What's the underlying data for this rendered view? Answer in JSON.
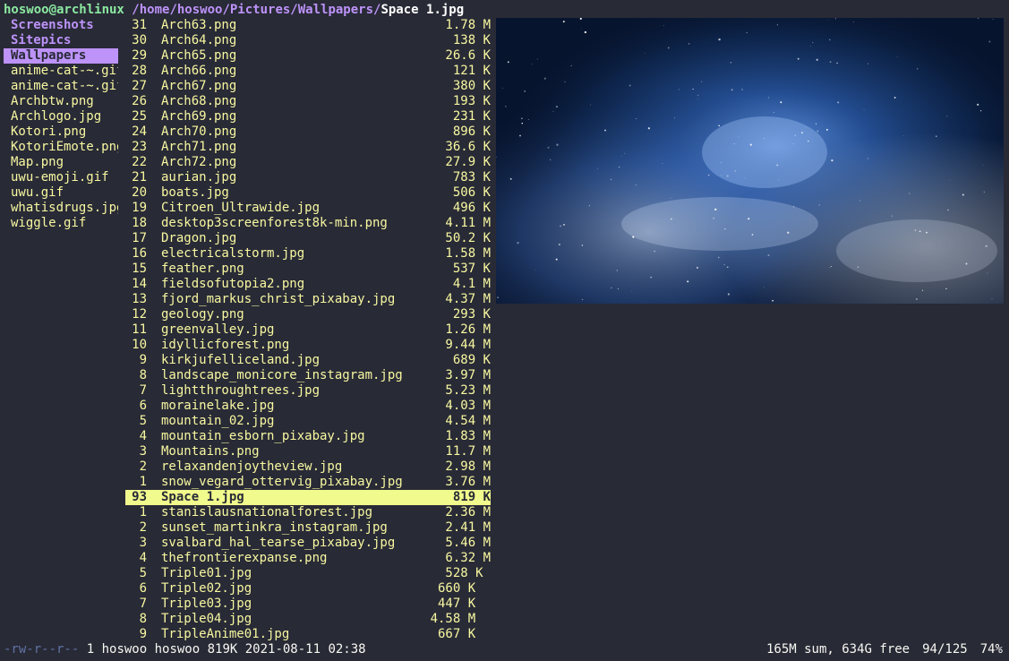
{
  "header": {
    "user_host": "hoswoo@archlinux",
    "path": "/home/hoswoo/Pictures/Wallpapers/",
    "current_file": "Space 1.jpg"
  },
  "parent_column": [
    {
      "name": "Screenshots",
      "type": "dir"
    },
    {
      "name": "Sitepics",
      "type": "dir"
    },
    {
      "name": "Wallpapers",
      "type": "dir",
      "selected": true
    },
    {
      "name": "anime-cat-~.gif"
    },
    {
      "name": "anime-cat-~.gif"
    },
    {
      "name": "Archbtw.png"
    },
    {
      "name": "Archlogo.jpg"
    },
    {
      "name": "Kotori.png"
    },
    {
      "name": "KotoriEmote.png"
    },
    {
      "name": "Map.png"
    },
    {
      "name": "uwu-emoji.gif"
    },
    {
      "name": "uwu.gif"
    },
    {
      "name": "whatisdrugs.jpg"
    },
    {
      "name": "wiggle.gif"
    }
  ],
  "files": [
    {
      "num": "31",
      "name": "Arch63.png",
      "size": "1.78 M"
    },
    {
      "num": "30",
      "name": "Arch64.png",
      "size": "138 K"
    },
    {
      "num": "29",
      "name": "Arch65.png",
      "size": "26.6 K"
    },
    {
      "num": "28",
      "name": "Arch66.png",
      "size": "121 K"
    },
    {
      "num": "27",
      "name": "Arch67.png",
      "size": "380 K"
    },
    {
      "num": "26",
      "name": "Arch68.png",
      "size": "193 K"
    },
    {
      "num": "25",
      "name": "Arch69.png",
      "size": "231 K"
    },
    {
      "num": "24",
      "name": "Arch70.png",
      "size": "896 K"
    },
    {
      "num": "23",
      "name": "Arch71.png",
      "size": "36.6 K"
    },
    {
      "num": "22",
      "name": "Arch72.png",
      "size": "27.9 K"
    },
    {
      "num": "21",
      "name": "aurian.jpg",
      "size": "783 K"
    },
    {
      "num": "20",
      "name": "boats.jpg",
      "size": "506 K"
    },
    {
      "num": "19",
      "name": "Citroen_Ultrawide.jpg",
      "size": "496 K"
    },
    {
      "num": "18",
      "name": "desktop3screenforest8k-min.png",
      "size": "4.11 M"
    },
    {
      "num": "17",
      "name": "Dragon.jpg",
      "size": "50.2 K"
    },
    {
      "num": "16",
      "name": "electricalstorm.jpg",
      "size": "1.58 M"
    },
    {
      "num": "15",
      "name": "feather.png",
      "size": "537 K"
    },
    {
      "num": "14",
      "name": "fieldsofutopia2.png",
      "size": "4.1 M"
    },
    {
      "num": "13",
      "name": "fjord_markus_christ_pixabay.jpg",
      "size": "4.37 M"
    },
    {
      "num": "12",
      "name": "geology.png",
      "size": "293 K"
    },
    {
      "num": "11",
      "name": "greenvalley.jpg",
      "size": "1.26 M"
    },
    {
      "num": "10",
      "name": "idyllicforest.png",
      "size": "9.44 M"
    },
    {
      "num": "9",
      "name": "kirkjufelliceland.jpg",
      "size": "689 K"
    },
    {
      "num": "8",
      "name": "landscape_monicore_instagram.jpg",
      "size": "3.97 M"
    },
    {
      "num": "7",
      "name": "lightthroughtrees.jpg",
      "size": "5.23 M"
    },
    {
      "num": "6",
      "name": "morainelake.jpg",
      "size": "4.03 M"
    },
    {
      "num": "5",
      "name": "mountain_02.jpg",
      "size": "4.54 M"
    },
    {
      "num": "4",
      "name": "mountain_esborn_pixabay.jpg",
      "size": "1.83 M"
    },
    {
      "num": "3",
      "name": "Mountains.png",
      "size": "11.7 M"
    },
    {
      "num": "2",
      "name": "relaxandenjoytheview.jpg",
      "size": "2.98 M"
    },
    {
      "num": "1",
      "name": "snow_vegard_ottervig_pixabay.jpg",
      "size": "3.76 M"
    },
    {
      "num": "93",
      "name": "Space 1.jpg",
      "size": "819 K",
      "selected": true
    },
    {
      "num": "1",
      "name": "stanislausnationalforest.jpg",
      "size": "2.36 M"
    },
    {
      "num": "2",
      "name": "sunset_martinkra_instagram.jpg",
      "size": "2.41 M"
    },
    {
      "num": "3",
      "name": "svalbard_hal_tearse_pixabay.jpg",
      "size": "5.46 M"
    },
    {
      "num": "4",
      "name": "thefrontierexpanse.png",
      "size": "6.32 M"
    },
    {
      "num": "5",
      "name": "Triple01.jpg",
      "size": "528 K "
    },
    {
      "num": "6",
      "name": "Triple02.jpg",
      "size": "660 K  "
    },
    {
      "num": "7",
      "name": "Triple03.jpg",
      "size": "447 K  "
    },
    {
      "num": "8",
      "name": "Triple04.jpg",
      "size": "4.58 M  "
    },
    {
      "num": "9",
      "name": "TripleAnime01.jpg",
      "size": "667 K  "
    }
  ],
  "status": {
    "permissions": "-rw-r--r--",
    "info": "1 hoswoo hoswoo 819K 2021-08-11 02:38",
    "disk": "165M sum, 634G free",
    "position": "94/125",
    "percent": "74%"
  },
  "colors": {
    "background": "#282a36",
    "file_text": "#f8f8a0",
    "directory": "#bd93f9",
    "selection_file": "#f1fa8c",
    "user_host": "#8be9a0"
  }
}
